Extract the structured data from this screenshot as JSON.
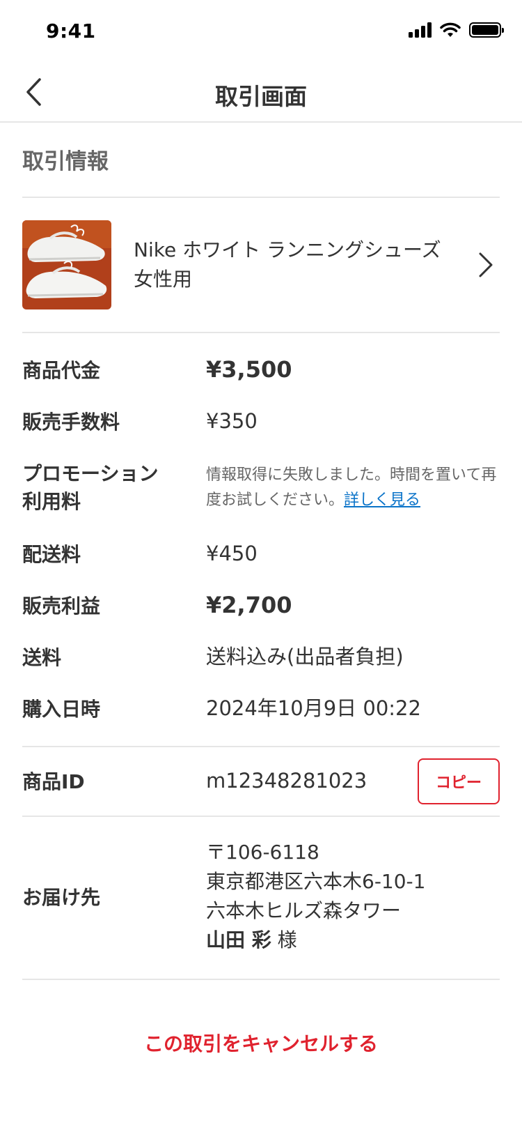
{
  "status_bar": {
    "time": "9:41",
    "icons": [
      "signal-icon",
      "wifi-icon",
      "battery-icon"
    ]
  },
  "nav": {
    "title": "取引画面",
    "back_icon": "chevron-left-icon"
  },
  "section": {
    "title": "取引情報"
  },
  "product": {
    "name": "Nike ホワイト ランニングシューズ 女性用",
    "image": "white-running-shoes-photo",
    "chevron_icon": "chevron-right-icon"
  },
  "details": {
    "price": {
      "label": "商品代金",
      "value": "¥3,500"
    },
    "fee": {
      "label": "販売手数料",
      "value": "¥350"
    },
    "promotion": {
      "label_line1": "プロモーション",
      "label_line2": "利用料",
      "message": "情報取得に失敗しました。時間を置いて再度お試しください。",
      "link": "詳しく見る"
    },
    "delivery_fee": {
      "label": "配送料",
      "value": "¥450"
    },
    "profit": {
      "label": "販売利益",
      "value": "¥2,700"
    },
    "shipping": {
      "label": "送料",
      "value": "送料込み(出品者負担)"
    },
    "purchase_date": {
      "label": "購入日時",
      "value": "2024年10月9日 00:22"
    },
    "item_id": {
      "label": "商品ID",
      "value": "m12348281023",
      "copy_label": "コピー"
    },
    "address": {
      "label": "お届け先",
      "postal": "〒106-6118",
      "line1": "東京都港区六本木6-10-1",
      "line2": "六本木ヒルズ森タワー",
      "name": "山田 彩",
      "honorific": "様"
    }
  },
  "cancel_label": "この取引をキャンセルする",
  "colors": {
    "accent_red": "#e0222e",
    "link_blue": "#0a73c9",
    "divider": "#e6e6e6"
  }
}
